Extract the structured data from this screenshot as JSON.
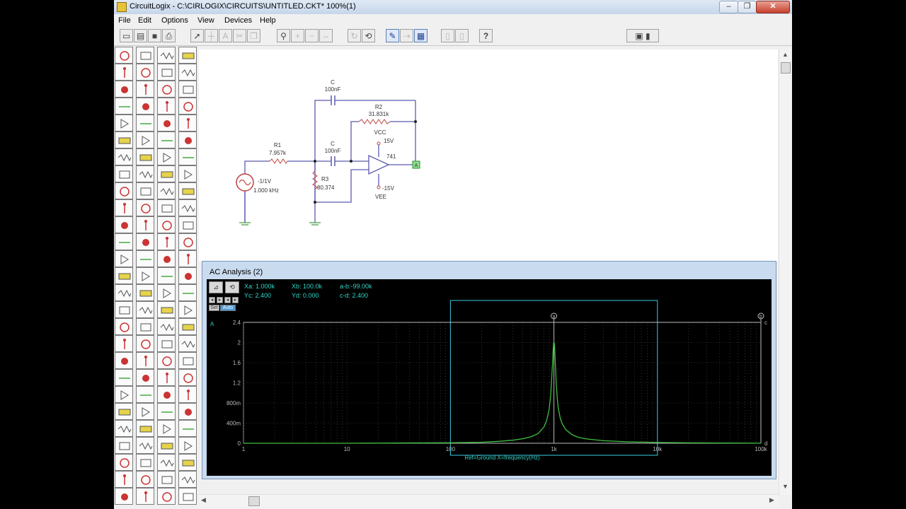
{
  "window": {
    "app_name": "CircuitLogix",
    "title": "CircuitLogix - C:\\CIRLOGIX\\CIRCUITS\\UNTITLED.CKT* 100%(1)",
    "min_glyph": "–",
    "max_glyph": "❐",
    "close_glyph": "✕"
  },
  "menu": [
    "File",
    "Edit",
    "Options",
    "View",
    "Devices",
    "Help"
  ],
  "toolbar": {
    "icons": [
      "new-icon",
      "open-icon",
      "save-icon",
      "print-icon",
      "pointer-icon",
      "wire-icon",
      "text-icon",
      "cut-icon",
      "copy-icon",
      "zoom-icon",
      "zoom-in-icon",
      "zoom-out-icon",
      "fit-icon",
      "rotate-icon",
      "undo-icon",
      "simulate-icon",
      "probe-icon",
      "analysis-icon",
      "cursor-a-icon",
      "cursor-b-icon",
      "help-icon",
      "info-icon"
    ],
    "help_label": "?"
  },
  "schematic": {
    "c_top_name": "C",
    "c_top_value": "100nF",
    "r2_name": "R2",
    "r2_value": "31.831k",
    "vcc_label": "VCC",
    "vcc_value": "15V",
    "c_mid_name": "C",
    "c_mid_value": "100nF",
    "r1_name": "R1",
    "r1_value": "7.957k",
    "opamp_label": "741",
    "source_value": "-1/1V",
    "source_freq": "1.000 kHz",
    "r3_name": "R3",
    "r3_value": "80.374",
    "vee_value": "-15V",
    "vee_label": "VEE",
    "probe_label": "A"
  },
  "analysis": {
    "window_title": "AC Analysis (2)",
    "readout": {
      "xa": "Xa: 1.000k",
      "xb": "Xb: 100.0k",
      "ab": "a-b:-99.00k",
      "yc": "Yc: 2.400",
      "yd": "Yd: 0.000",
      "cd": "c-d: 2.400"
    },
    "mode_buttons": [
      "Set",
      "Auto"
    ],
    "y_axis_name": "A",
    "cursor_c_tag": "c",
    "cursor_d_tag": "d",
    "cursor_a_tag": "a",
    "cursor_b_tag": "b",
    "x_axis_label": "Ref=Ground  X=frequency(Hz)"
  },
  "chart_data": {
    "type": "line",
    "title": "",
    "xlabel": "Ref=Ground  X=frequency(Hz)",
    "ylabel": "",
    "x_scale": "log",
    "xlim": [
      1,
      100000
    ],
    "ylim": [
      0,
      2.4
    ],
    "x_ticks": [
      1,
      10,
      100,
      1000,
      10000,
      100000
    ],
    "x_tick_labels": [
      "1",
      "10",
      "100",
      "1k",
      "10k",
      "100k"
    ],
    "y_ticks": [
      0,
      0.4,
      0.8,
      1.2,
      1.6,
      2.0,
      2.4
    ],
    "y_tick_labels": [
      "0",
      "400m",
      "800m",
      "1.2",
      "1.6",
      "2",
      "2.4"
    ],
    "grid": true,
    "line_color": "#3fbf3f",
    "series": [
      {
        "x": [
          1,
          10,
          100,
          200,
          300,
          400,
          500,
          600,
          700,
          800,
          850,
          900,
          930,
          950,
          970,
          980,
          990,
          1000,
          1010,
          1020,
          1030,
          1050,
          1080,
          1100,
          1150,
          1200,
          1300,
          1500,
          1700,
          2000,
          3000,
          5000,
          10000,
          20000,
          50000,
          100000
        ],
        "y": [
          0.0,
          0.0,
          0.01,
          0.02,
          0.04,
          0.06,
          0.09,
          0.13,
          0.19,
          0.32,
          0.45,
          0.68,
          0.95,
          1.25,
          1.6,
          1.8,
          1.98,
          2.0,
          1.98,
          1.82,
          1.62,
          1.22,
          0.86,
          0.7,
          0.5,
          0.39,
          0.27,
          0.17,
          0.12,
          0.09,
          0.05,
          0.03,
          0.015,
          0.008,
          0.004,
          0.002
        ]
      }
    ],
    "cursors": {
      "xa": 1000,
      "xb": 100000,
      "yc": 2.4,
      "yd": 0.0
    },
    "zoom_box": {
      "x": [
        100,
        10000
      ],
      "y": [
        0,
        2.4
      ]
    }
  }
}
